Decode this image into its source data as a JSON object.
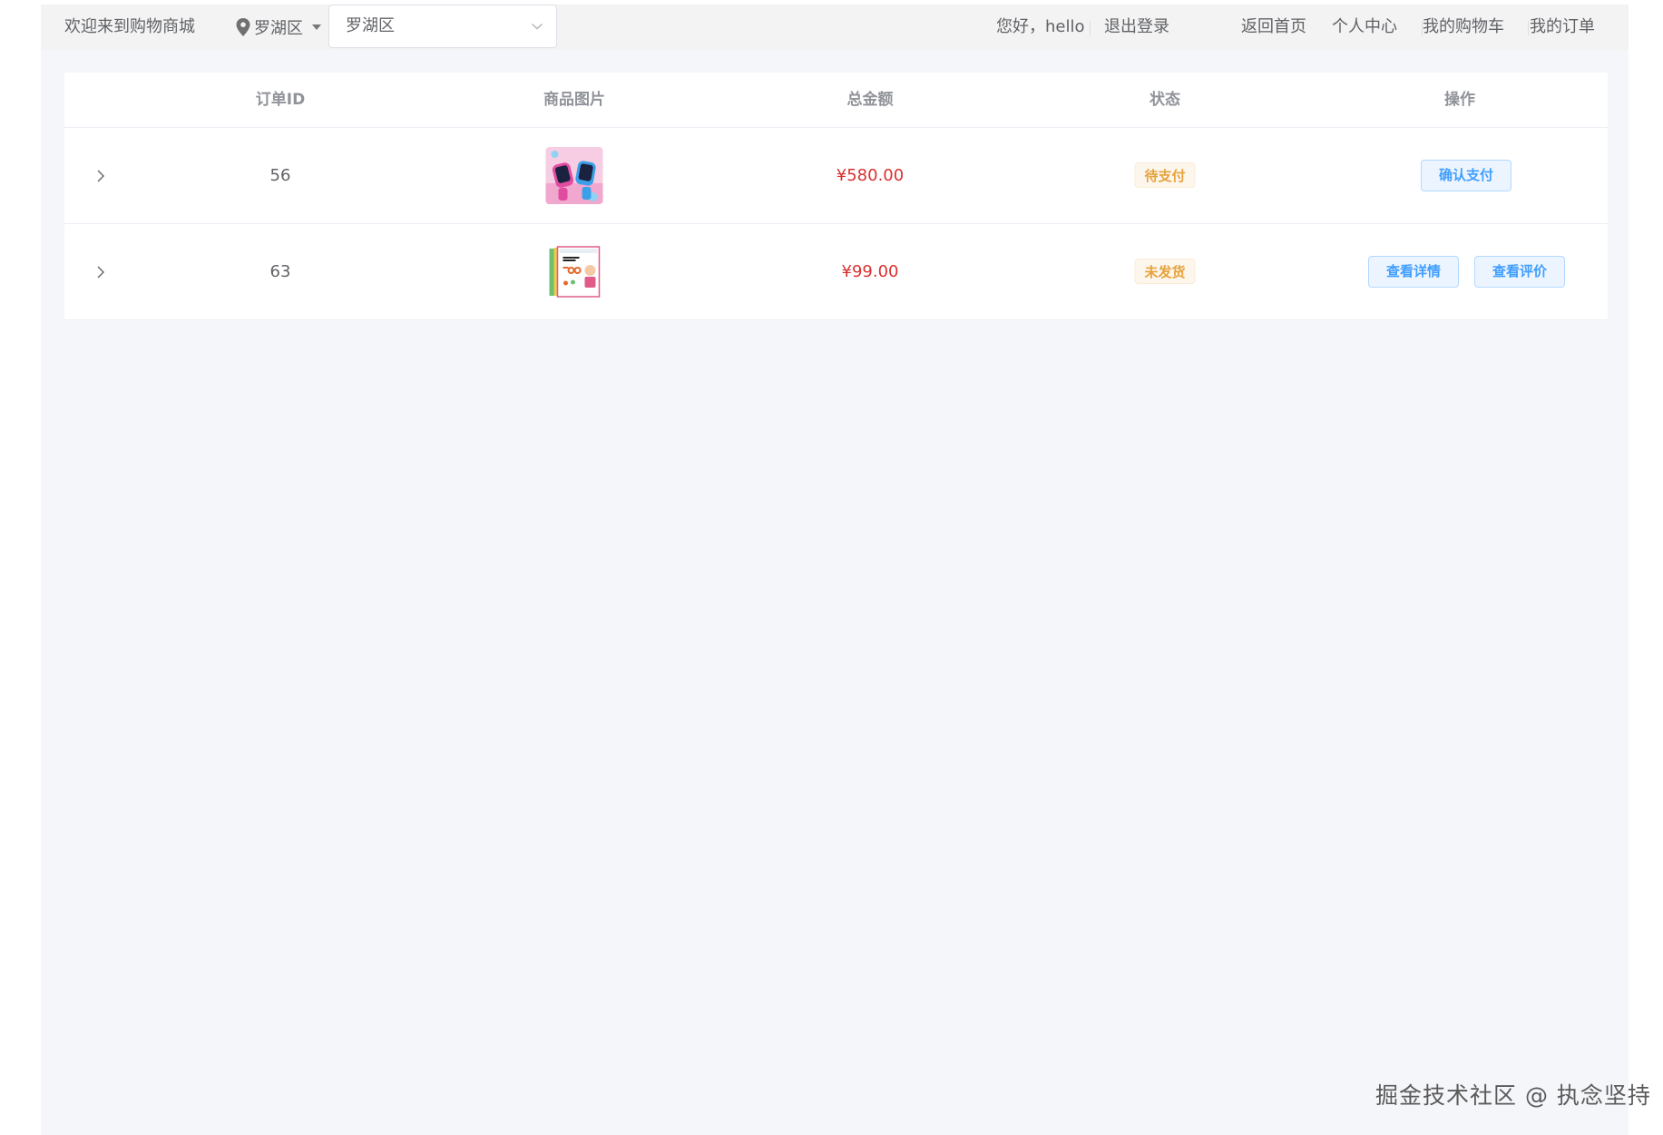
{
  "header": {
    "welcome": "欢迎来到购物商城",
    "location_label": "罗湖区",
    "location_select_value": "罗湖区",
    "greeting": "您好，hello",
    "logout": "退出登录",
    "nav": [
      "返回首页",
      "个人中心",
      "我的购物车",
      "我的订单"
    ]
  },
  "table": {
    "columns": [
      "订单ID",
      "商品图片",
      "总金额",
      "状态",
      "操作"
    ],
    "rows": [
      {
        "id": "56",
        "amount": "¥580.00",
        "status": "待支付",
        "actions": [
          "确认支付"
        ]
      },
      {
        "id": "63",
        "amount": "¥99.00",
        "status": "未发货",
        "actions": [
          "查看详情",
          "查看评价"
        ]
      }
    ]
  },
  "watermark": "掘金技术社区 @ 执念坚持",
  "colors": {
    "amount": "#d9312f",
    "status_warning": "#e6a23c",
    "button_primary": "#409eff"
  },
  "icons": {
    "location": "map-pin-icon",
    "caret": "caret-down-icon",
    "select": "chevron-down-icon",
    "expand": "chevron-right-icon"
  }
}
